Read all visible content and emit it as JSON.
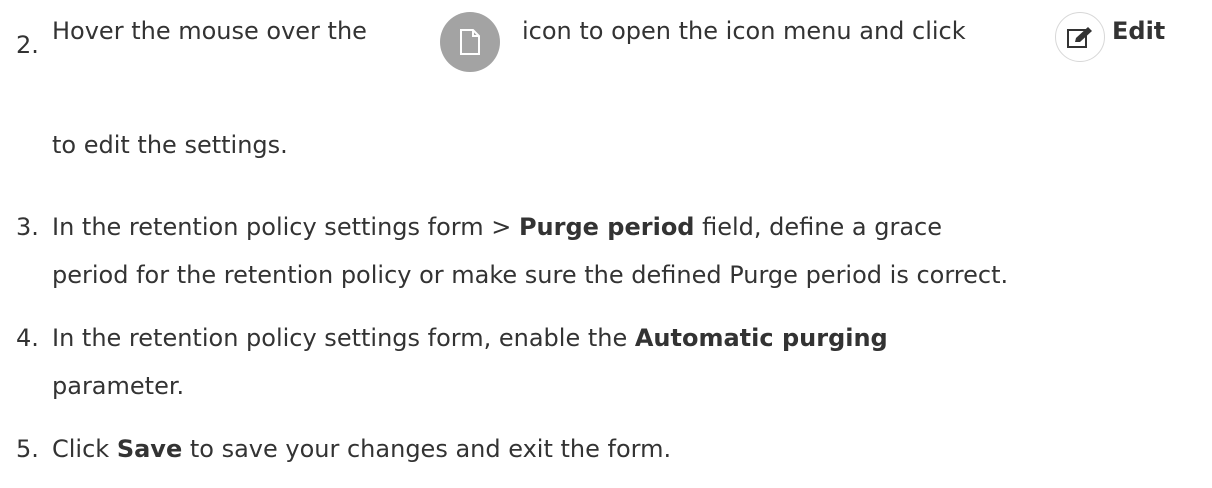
{
  "steps": [
    {
      "number": "2.",
      "prefix": "Hover the mouse over the",
      "middle": "icon to open the icon menu and click",
      "bold": "Edit",
      "continuation": "to edit the settings.",
      "icons": [
        "document-icon",
        "edit-icon"
      ]
    },
    {
      "number": "3.",
      "prefix": "In the retention policy settings form > ",
      "bold": "Purge period",
      "suffix": " field, define a grace",
      "continuation": "period for the retention policy or make sure the defined Purge period is correct."
    },
    {
      "number": "4.",
      "prefix": "In the retention policy settings form, enable the ",
      "bold": "Automatic purging",
      "continuation": "parameter."
    },
    {
      "number": "5.",
      "prefix": "Click ",
      "bold": "Save",
      "suffix": " to save your changes and exit the form."
    }
  ],
  "colors": {
    "text": "#333333",
    "icon_circle": "#a3a3a3",
    "edit_circle_border": "#d8d8d8"
  }
}
